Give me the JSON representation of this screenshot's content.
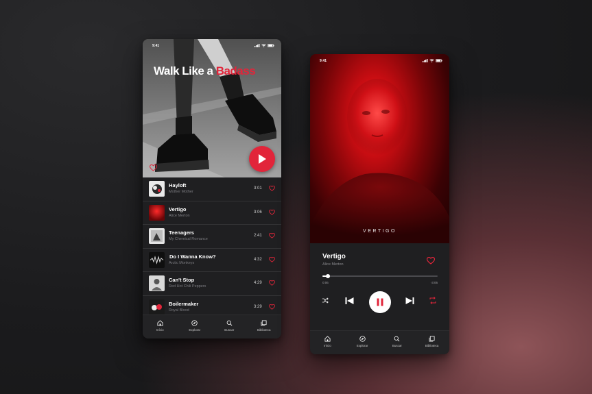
{
  "status": {
    "time": "9:41"
  },
  "playlist": {
    "title_part1": "Walk Like a ",
    "title_part2": "Badass",
    "tracks": [
      {
        "title": "Hayloft",
        "artist": "Mother Mother",
        "duration": "3:01"
      },
      {
        "title": "Vertigo",
        "artist": "Alice Merton",
        "duration": "3:06"
      },
      {
        "title": "Teenagers",
        "artist": "My Chemical Romance",
        "duration": "2:41"
      },
      {
        "title": "Do I Wanna Know?",
        "artist": "Arctic Monkeys",
        "duration": "4:32"
      },
      {
        "title": "Can't Stop",
        "artist": "Red Hot Chili Peppers",
        "duration": "4:29"
      },
      {
        "title": "Boilermaker",
        "artist": "Royal Blood",
        "duration": "3:29"
      }
    ]
  },
  "now_playing": {
    "art_title": "VERTIGO",
    "title": "Vertigo",
    "artist": "Alice Merton",
    "elapsed": "0:06",
    "remaining": "-3:06",
    "progress": 0.05
  },
  "tabs": [
    {
      "label": "Início",
      "icon": "home-icon"
    },
    {
      "label": "Explorar",
      "icon": "compass-icon"
    },
    {
      "label": "Buscar",
      "icon": "search-icon"
    },
    {
      "label": "Biblioteca",
      "icon": "library-icon"
    }
  ],
  "colors": {
    "accent": "#e2253a",
    "background": "#1f1f21"
  }
}
